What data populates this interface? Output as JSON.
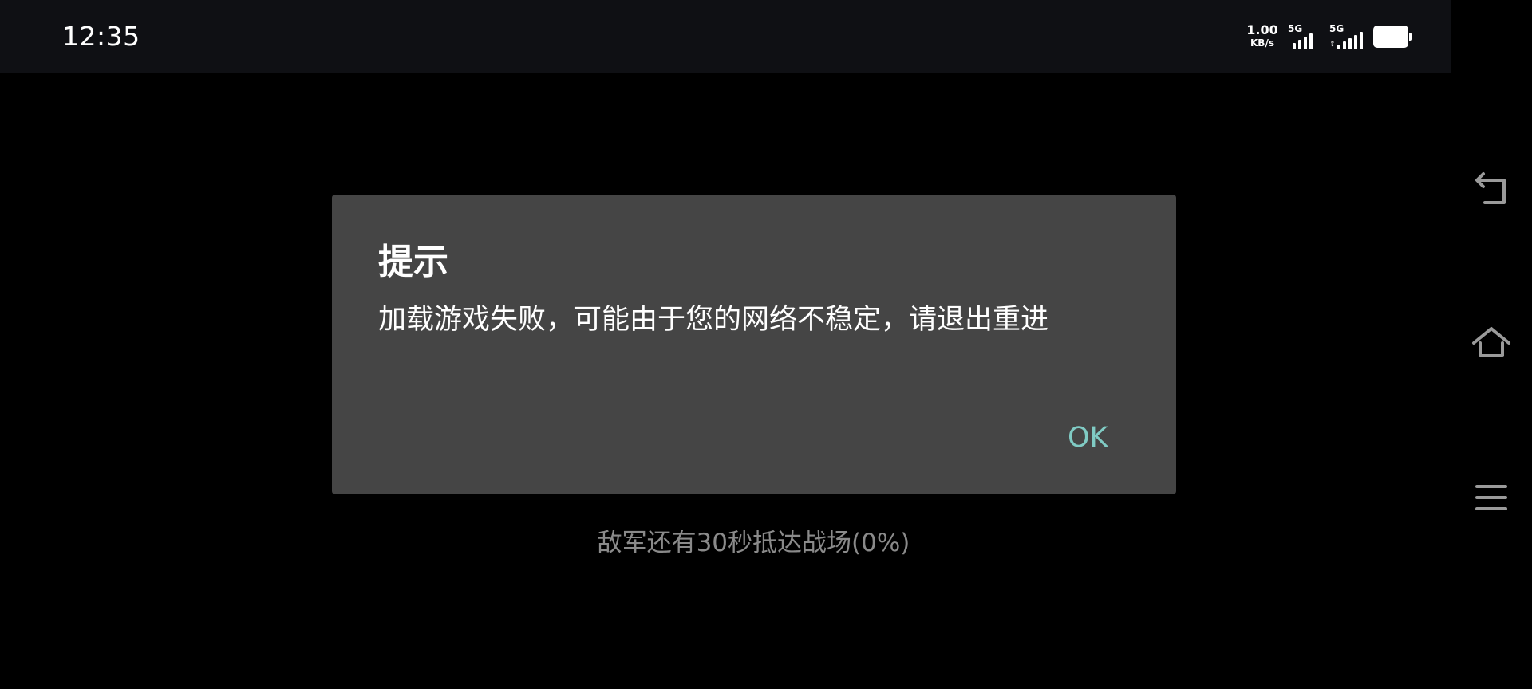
{
  "status_bar": {
    "time": "12:35",
    "net_speed_value": "1.00",
    "net_speed_unit": "KB/s",
    "signal_1_label": "5G",
    "signal_2_label": "5G",
    "icons": [
      "signal-icon",
      "signal-icon",
      "battery-icon"
    ]
  },
  "dialog": {
    "title": "提示",
    "message": "加载游戏失败，可能由于您的网络不稳定，请退出重进",
    "ok_label": "OK"
  },
  "game": {
    "loading_text": "敌军还有30秒抵达战场(0%)",
    "loading_progress_percent": 0
  },
  "nav_bar": {
    "icons": [
      "back-icon",
      "home-icon",
      "menu-icon"
    ]
  },
  "colors": {
    "background": "#000000",
    "status_bar": "#0f1014",
    "dialog_background": "#454545",
    "dialog_text": "#ffffff",
    "ok_button": "#80cbc4",
    "loading_text": "#8a8a8a"
  }
}
